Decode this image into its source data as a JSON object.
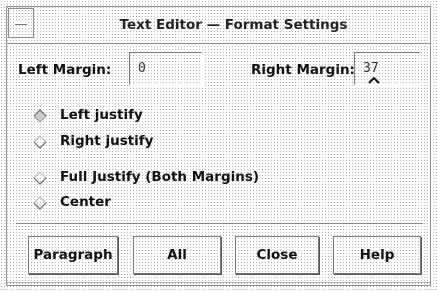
{
  "window": {
    "title": "Text Editor — Format Settings"
  },
  "margins": {
    "left_label": "Left Margin:",
    "left_value": "0",
    "right_label": "Right Margin:",
    "right_value": "37"
  },
  "justify_options": [
    {
      "label": "Left justify",
      "selected": true
    },
    {
      "label": "Right justify",
      "selected": false
    },
    {
      "label": "Full Justify (Both Margins)",
      "selected": false
    },
    {
      "label": "Center",
      "selected": false
    }
  ],
  "buttons": {
    "paragraph": "Paragraph",
    "all": "All",
    "close": "Close",
    "help": "Help"
  }
}
